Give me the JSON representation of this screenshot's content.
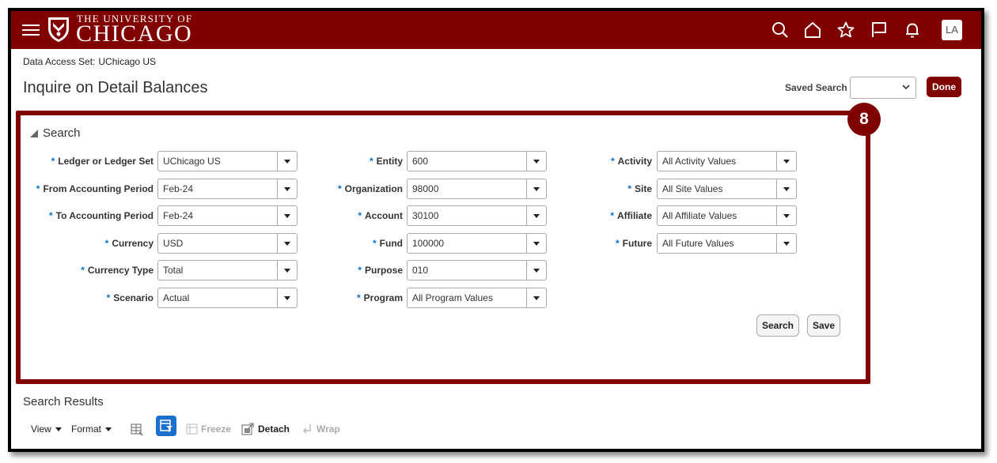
{
  "header": {
    "logo_line1": "THE UNIVERSITY OF",
    "logo_line2": "CHICAGO",
    "avatar_initials": "LA",
    "brand_color": "#800000",
    "icons": [
      "menu-icon",
      "search-icon",
      "home-icon",
      "favorites-star-icon",
      "flag-icon",
      "notifications-bell-icon"
    ]
  },
  "context": {
    "data_access_set_label": "Data Access Set:",
    "data_access_set_value": "UChicago US"
  },
  "page": {
    "title": "Inquire on Detail Balances",
    "saved_search_label": "Saved Search",
    "saved_search_value": "",
    "done_label": "Done"
  },
  "callout": {
    "number": "8"
  },
  "search_panel": {
    "title": "Search",
    "fields": {
      "ledger": {
        "label": "Ledger or Ledger Set",
        "value": "UChicago US"
      },
      "from_period": {
        "label": "From Accounting Period",
        "value": "Feb-24"
      },
      "to_period": {
        "label": "To Accounting Period",
        "value": "Feb-24"
      },
      "currency": {
        "label": "Currency",
        "value": "USD"
      },
      "currency_type": {
        "label": "Currency Type",
        "value": "Total"
      },
      "scenario": {
        "label": "Scenario",
        "value": "Actual"
      },
      "entity": {
        "label": "Entity",
        "value": "600"
      },
      "organization": {
        "label": "Organization",
        "value": "98000"
      },
      "account": {
        "label": "Account",
        "value": "30100"
      },
      "fund": {
        "label": "Fund",
        "value": "100000"
      },
      "purpose": {
        "label": "Purpose",
        "value": "010"
      },
      "program": {
        "label": "Program",
        "value": "All Program Values"
      },
      "activity": {
        "label": "Activity",
        "value": "All Activity Values"
      },
      "site": {
        "label": "Site",
        "value": "All Site Values"
      },
      "affiliate": {
        "label": "Affiliate",
        "value": "All Affiliate Values"
      },
      "future": {
        "label": "Future",
        "value": "All Future Values"
      }
    },
    "required_marker": "*",
    "search_button": "Search",
    "save_button": "Save"
  },
  "results": {
    "title": "Search Results",
    "toolbar": {
      "view": "View",
      "format": "Format",
      "freeze": "Freeze",
      "detach": "Detach",
      "wrap": "Wrap"
    }
  }
}
